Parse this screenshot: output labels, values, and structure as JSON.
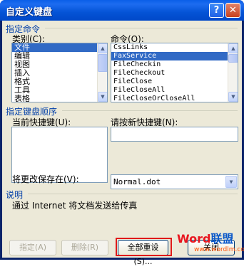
{
  "window": {
    "title": "自定义键盘"
  },
  "titlebar": {
    "help_label": "?",
    "close_label": "✕"
  },
  "specify_command": {
    "group_title": "指定命令",
    "categories_label": "类别(C):",
    "categories": [
      "文件",
      "编辑",
      "视图",
      "插入",
      "格式",
      "工具",
      "表格"
    ],
    "categories_selected": "文件",
    "commands_label": "命令(O):",
    "commands": [
      "CssLinks",
      "FaxService",
      "FileCheckin",
      "FileCheckout",
      "FileClose",
      "FileCloseAll",
      "FileCloseOrCloseAll"
    ],
    "commands_selected": "FaxService"
  },
  "key_sequence": {
    "group_title": "指定键盘顺序",
    "current_keys_label": "当前快捷键(U):",
    "new_key_label": "请按新快捷键(N):",
    "new_key_value": "",
    "save_in_label": "将更改保存在(V):",
    "save_in_value": "Normal.dot"
  },
  "description": {
    "group_title": "说明",
    "text": "通过 Internet 将文档发送给传真"
  },
  "buttons": {
    "assign": "指定(A)",
    "remove": "删除(R)",
    "reset_all": "全部重设(S)...",
    "close": "关闭"
  },
  "watermark": {
    "word": "Word",
    "cn": "联盟",
    "url": "www.wordlm.com"
  },
  "colors": {
    "title_bar": "#0453d6",
    "selection": "#316ac5",
    "group_title": "#003ea8",
    "highlight_frame": "#e01a1a"
  }
}
